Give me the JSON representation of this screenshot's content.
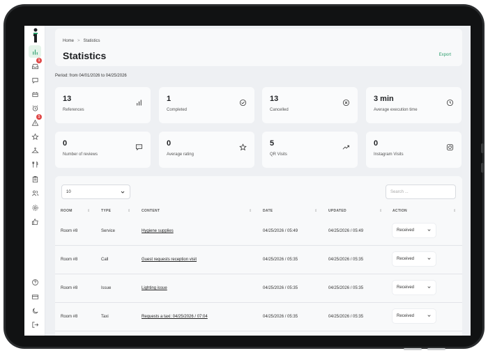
{
  "breadcrumb": {
    "home": "Home",
    "separator": ">",
    "current": "Statistics"
  },
  "page": {
    "title": "Statistics",
    "export_label": "Export",
    "period": "Period: from 04/01/2026 to 04/25/2026"
  },
  "sidebar": {
    "badges": {
      "inbox": "1",
      "alerts": "1"
    }
  },
  "stats": [
    {
      "value": "13",
      "label": "References",
      "icon": "bar-chart-icon"
    },
    {
      "value": "1",
      "label": "Completed",
      "icon": "check-circle-icon"
    },
    {
      "value": "13",
      "label": "Cancelled",
      "icon": "x-circle-icon"
    },
    {
      "value": "3 min",
      "label": "Average execution time",
      "icon": "clock-icon"
    },
    {
      "value": "0",
      "label": "Number of reviews",
      "icon": "message-icon"
    },
    {
      "value": "0",
      "label": "Average rating",
      "icon": "star-icon"
    },
    {
      "value": "5",
      "label": "QR Visits",
      "icon": "trending-up-icon"
    },
    {
      "value": "0",
      "label": "Instagram Visits",
      "icon": "instagram-icon"
    }
  ],
  "table": {
    "page_size": "10",
    "search_placeholder": "Search ...",
    "columns": [
      "ROOM",
      "TYPE",
      "CONTENT",
      "DATE",
      "UPDATED",
      "ACTION"
    ],
    "rows": [
      {
        "room": "Room #8",
        "type": "Service",
        "content": "Hygiene supplies",
        "date": "04/25/2026 / 05:49",
        "updated": "04/25/2026 / 05:49",
        "action": "Received"
      },
      {
        "room": "Room #8",
        "type": "Call",
        "content": "Guest requests reception visit",
        "date": "04/25/2026 / 05:35",
        "updated": "04/25/2026 / 05:35",
        "action": "Received"
      },
      {
        "room": "Room #8",
        "type": "Issue",
        "content": "Lighting issue",
        "date": "04/25/2026 / 05:35",
        "updated": "04/25/2026 / 05:35",
        "action": "Received"
      },
      {
        "room": "Room #8",
        "type": "Taxi",
        "content": "Requests a taxi: 04/25/2026 / 07:04",
        "date": "04/25/2026 / 05:35",
        "updated": "04/25/2026 / 05:35",
        "action": "Received"
      }
    ]
  },
  "colors": {
    "accent": "#2a9d6b",
    "badge": "#e04848",
    "background": "#eef0f3"
  }
}
